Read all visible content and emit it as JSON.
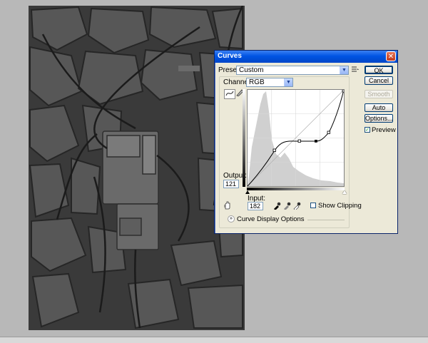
{
  "dialog": {
    "title": "Curves",
    "close_glyph": "✕",
    "preset_label": "Preset:",
    "preset_value": "Custom",
    "channel_label": "Channel:",
    "channel_value": "RGB",
    "output_label": "Output:",
    "output_value": "121",
    "input_label": "Input:",
    "input_value": "182",
    "show_clipping_label": "Show Clipping",
    "show_clipping_checked": false,
    "curve_display_options_label": "Curve Display Options",
    "preview_label": "Preview",
    "preview_checked": true,
    "buttons": {
      "ok": "OK",
      "cancel": "Cancel",
      "smooth": "Smooth",
      "auto": "Auto",
      "options": "Options..."
    },
    "icons": {
      "preset_options": "preset-menu-icon",
      "curve_point_tool": "curve-point-icon",
      "pencil_tool": "pencil-icon",
      "hand_adjust_tool": "on-image-adjust-icon",
      "black_eyedropper": "eyedropper-black-icon",
      "gray_eyedropper": "eyedropper-gray-icon",
      "white_eyedropper": "eyedropper-white-icon",
      "expand": "expand-chevron-icon"
    },
    "colors": {
      "title_bar": "#0054e3",
      "dialog_bg": "#ece9d8",
      "histogram": "#d0d0d0",
      "curve": "#000000"
    }
  }
}
